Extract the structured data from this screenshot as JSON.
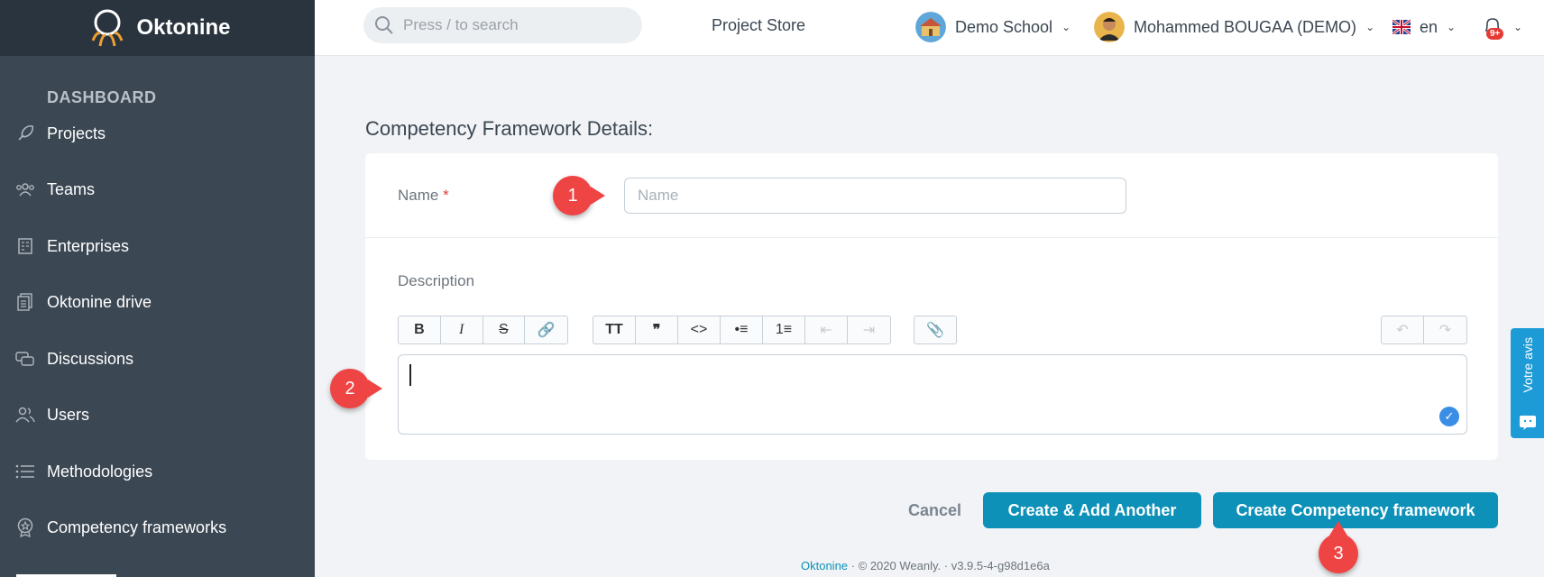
{
  "app": {
    "logo_text": "Oktonine"
  },
  "sidebar": {
    "section_title": "DASHBOARD",
    "items": [
      {
        "label": "Projects",
        "icon": "rocket-icon"
      },
      {
        "label": "Teams",
        "icon": "team-icon"
      },
      {
        "label": "Enterprises",
        "icon": "building-icon"
      },
      {
        "label": "Oktonine drive",
        "icon": "drive-icon"
      },
      {
        "label": "Discussions",
        "icon": "chat-icon"
      },
      {
        "label": "Users",
        "icon": "users-icon"
      },
      {
        "label": "Methodologies",
        "icon": "list-icon"
      },
      {
        "label": "Competency frameworks",
        "icon": "badge-icon"
      }
    ]
  },
  "header": {
    "search_placeholder": "Press / to search",
    "store_label": "Project Store",
    "school_label": "Demo School",
    "user_label": "Mohammed BOUGAA (DEMO)",
    "language_label": "en",
    "notifications_count": "9+"
  },
  "form": {
    "page_title": "Competency Framework Details:",
    "name_label": "Name",
    "name_required": "*",
    "name_placeholder": "Name",
    "name_value": "",
    "description_label": "Description"
  },
  "toolbar": {
    "group1": [
      "B",
      "I",
      "S",
      "🔗"
    ],
    "group2": [
      "TT",
      "❞",
      "<>",
      "•≡",
      "1≡",
      "⇤",
      "⇥"
    ],
    "group3": [
      "📎"
    ],
    "group4": [
      "↶",
      "↷"
    ]
  },
  "actions": {
    "cancel_label": "Cancel",
    "create_add_label": "Create & Add Another",
    "create_label": "Create Competency framework"
  },
  "footer": {
    "brand": "Oktonine",
    "copyright": "© 2020 Weanly.",
    "version": "v3.9.5-4-g98d1e6a"
  },
  "annotations": {
    "step1": "1",
    "step2": "2",
    "step3": "3"
  },
  "feedback": {
    "label": "Votre avis"
  },
  "colors": {
    "sidebar": "#3b4753",
    "primary": "#0e91b8",
    "badge": "#ef4444"
  }
}
